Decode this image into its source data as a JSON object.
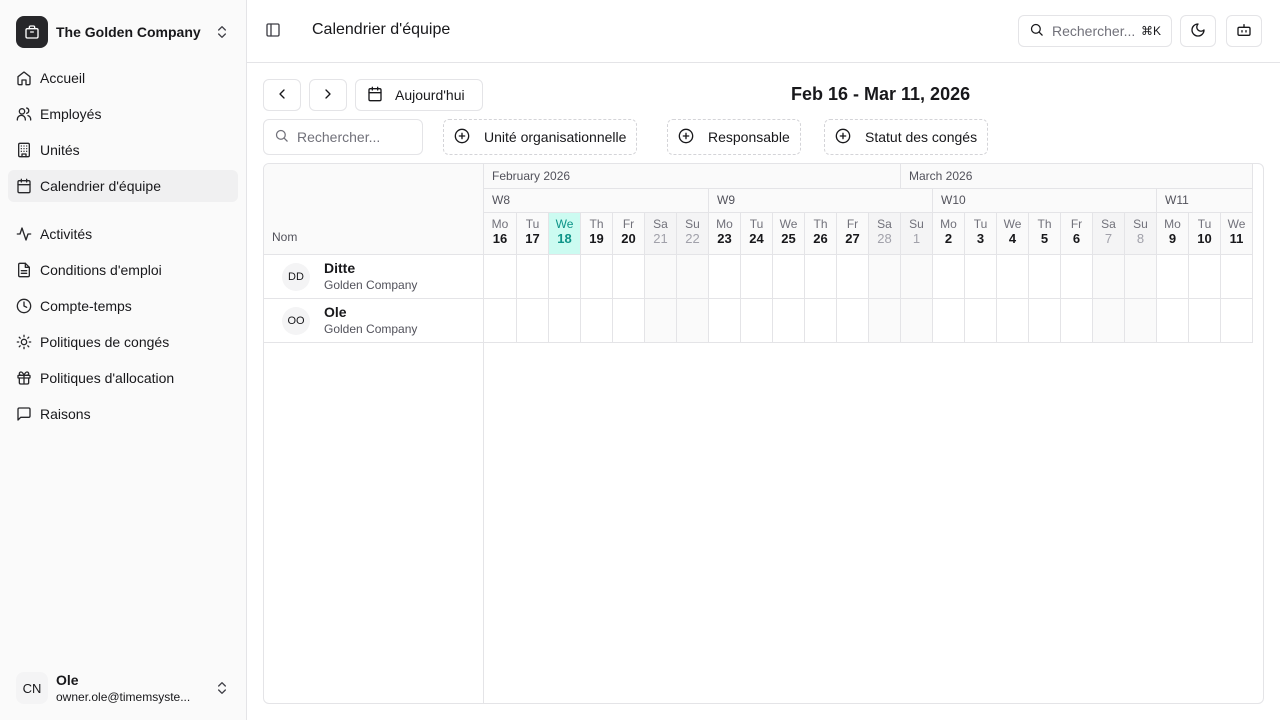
{
  "sidebar": {
    "company": {
      "name": "The Golden Company",
      "icon": "building-icon"
    },
    "nav_primary": [
      {
        "label": "Accueil",
        "icon": "home-icon",
        "active": false
      },
      {
        "label": "Employés",
        "icon": "users-icon",
        "active": false
      },
      {
        "label": "Unités",
        "icon": "building-icon",
        "active": false
      },
      {
        "label": "Calendrier d'équipe",
        "icon": "calendar-icon",
        "active": true
      }
    ],
    "nav_secondary": [
      {
        "label": "Activités",
        "icon": "activity-icon"
      },
      {
        "label": "Conditions d'emploi",
        "icon": "file-icon"
      },
      {
        "label": "Compte-temps",
        "icon": "clock-icon"
      },
      {
        "label": "Politiques de congés",
        "icon": "sun-icon"
      },
      {
        "label": "Politiques d'allocation",
        "icon": "gift-icon"
      },
      {
        "label": "Raisons",
        "icon": "message-icon"
      }
    ],
    "user": {
      "initials": "CN",
      "name": "Ole",
      "email": "owner.ole@timemsyste..."
    }
  },
  "header": {
    "title": "Calendrier d'équipe",
    "search_placeholder": "Rechercher...",
    "search_shortcut": "⌘K"
  },
  "toolbar": {
    "today_label": "Aujourd'hui",
    "range_title": "Feb 16 - Mar 11, 2026",
    "search_placeholder": "Rechercher...",
    "filters": [
      "Unité organisationnelle",
      "Responsable",
      "Statut des congés"
    ]
  },
  "calendar": {
    "name_header": "Nom",
    "months": [
      "February 2026",
      "March 2026"
    ],
    "weeks": [
      "W8",
      "W9",
      "W10",
      "W11"
    ],
    "days": [
      {
        "dn": "Mo",
        "dd": "16"
      },
      {
        "dn": "Tu",
        "dd": "17"
      },
      {
        "dn": "We",
        "dd": "18",
        "today": true
      },
      {
        "dn": "Th",
        "dd": "19"
      },
      {
        "dn": "Fr",
        "dd": "20"
      },
      {
        "dn": "Sa",
        "dd": "21",
        "weekend": true
      },
      {
        "dn": "Su",
        "dd": "22",
        "weekend": true
      },
      {
        "dn": "Mo",
        "dd": "23"
      },
      {
        "dn": "Tu",
        "dd": "24"
      },
      {
        "dn": "We",
        "dd": "25"
      },
      {
        "dn": "Th",
        "dd": "26"
      },
      {
        "dn": "Fr",
        "dd": "27"
      },
      {
        "dn": "Sa",
        "dd": "28",
        "weekend": true
      },
      {
        "dn": "Su",
        "dd": "1",
        "weekend": true
      },
      {
        "dn": "Mo",
        "dd": "2"
      },
      {
        "dn": "Tu",
        "dd": "3"
      },
      {
        "dn": "We",
        "dd": "4"
      },
      {
        "dn": "Th",
        "dd": "5"
      },
      {
        "dn": "Fr",
        "dd": "6"
      },
      {
        "dn": "Sa",
        "dd": "7",
        "weekend": true
      },
      {
        "dn": "Su",
        "dd": "8",
        "weekend": true
      },
      {
        "dn": "Mo",
        "dd": "9"
      },
      {
        "dn": "Tu",
        "dd": "10"
      },
      {
        "dn": "We",
        "dd": "11"
      }
    ],
    "employees": [
      {
        "initials": "DD",
        "name": "Ditte",
        "unit": "Golden Company"
      },
      {
        "initials": "OO",
        "name": "Ole",
        "unit": "Golden Company"
      }
    ]
  },
  "colors": {
    "today": "#0d9488",
    "today_bg": "#ccfbf1",
    "active_nav": "#f0f0f1"
  }
}
